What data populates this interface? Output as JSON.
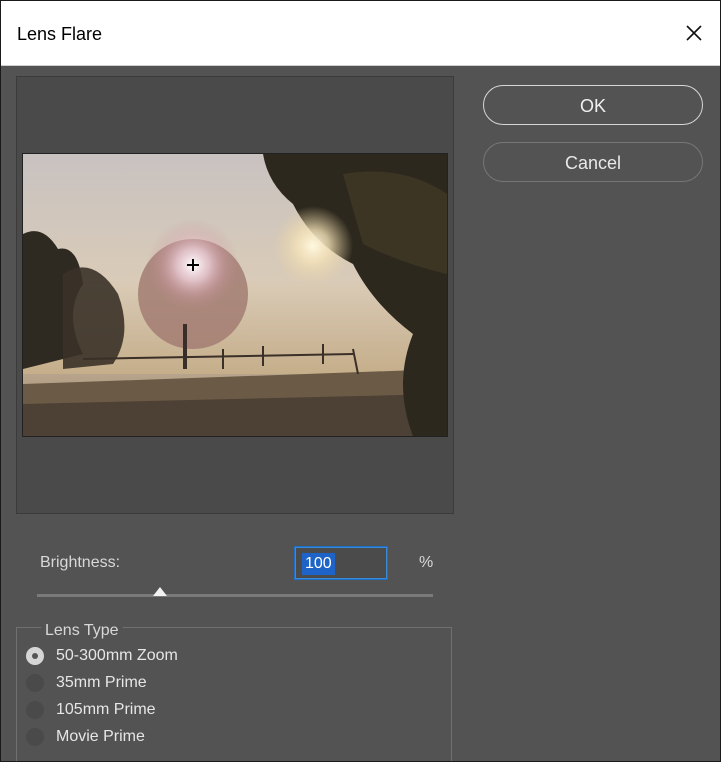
{
  "window": {
    "title": "Lens Flare"
  },
  "buttons": {
    "ok": "OK",
    "cancel": "Cancel"
  },
  "brightness": {
    "label": "Brightness:",
    "value": "100",
    "unit": "%",
    "slider_level_percent": 31
  },
  "lens_type": {
    "title": "Lens Type",
    "options": [
      {
        "label": "50-300mm Zoom",
        "checked": true
      },
      {
        "label": "35mm Prime",
        "checked": false
      },
      {
        "label": "105mm Prime",
        "checked": false
      },
      {
        "label": "Movie Prime",
        "checked": false
      }
    ]
  },
  "icons": {
    "close": "close-icon",
    "flare_center": "crosshair-icon"
  }
}
